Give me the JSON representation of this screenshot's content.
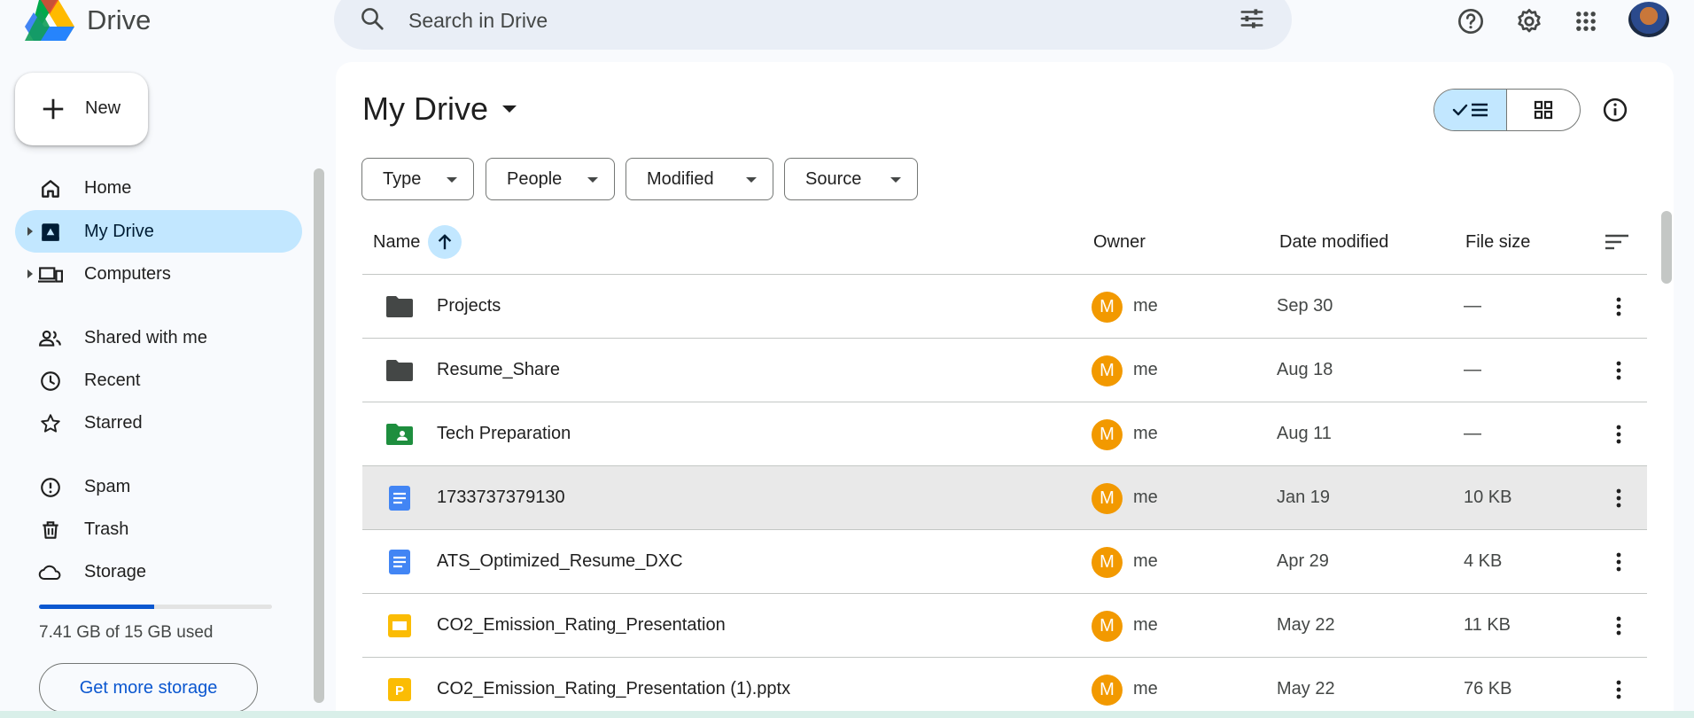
{
  "app": {
    "name": "Drive"
  },
  "search": {
    "placeholder": "Search in Drive"
  },
  "sidebar": {
    "new_label": "New",
    "items": [
      {
        "label": "Home",
        "icon": "home-icon"
      },
      {
        "label": "My Drive",
        "icon": "my-drive-icon",
        "active": true
      },
      {
        "label": "Computers",
        "icon": "computers-icon"
      },
      {
        "label": "Shared with me",
        "icon": "shared-icon"
      },
      {
        "label": "Recent",
        "icon": "clock-icon"
      },
      {
        "label": "Starred",
        "icon": "star-icon"
      },
      {
        "label": "Spam",
        "icon": "spam-icon"
      },
      {
        "label": "Trash",
        "icon": "trash-icon"
      },
      {
        "label": "Storage",
        "icon": "cloud-icon"
      }
    ],
    "storage": {
      "text": "7.41 GB of 15 GB used",
      "used_fraction": 0.494,
      "button": "Get more storage"
    }
  },
  "main": {
    "title": "My Drive",
    "filters": [
      "Type",
      "People",
      "Modified",
      "Source"
    ],
    "columns": {
      "name": "Name",
      "owner": "Owner",
      "date": "Date modified",
      "size": "File size"
    },
    "rows": [
      {
        "name": "Projects",
        "type": "folder",
        "owner_initial": "M",
        "owner": "me",
        "date": "Sep 30",
        "size": "—"
      },
      {
        "name": "Resume_Share",
        "type": "folder",
        "owner_initial": "M",
        "owner": "me",
        "date": "Aug 18",
        "size": "—"
      },
      {
        "name": "Tech Preparation",
        "type": "shared-folder",
        "owner_initial": "M",
        "owner": "me",
        "date": "Aug 11",
        "size": "—"
      },
      {
        "name": "1733737379130",
        "type": "doc",
        "owner_initial": "M",
        "owner": "me",
        "date": "Jan 19",
        "size": "10 KB",
        "selected": true
      },
      {
        "name": "ATS_Optimized_Resume_DXC",
        "type": "doc",
        "owner_initial": "M",
        "owner": "me",
        "date": "Apr 29",
        "size": "4 KB"
      },
      {
        "name": "CO2_Emission_Rating_Presentation",
        "type": "slides",
        "owner_initial": "M",
        "owner": "me",
        "date": "May 22",
        "size": "11 KB"
      },
      {
        "name": "CO2_Emission_Rating_Presentation (1).pptx",
        "type": "pptx",
        "owner_initial": "M",
        "owner": "me",
        "date": "May 22",
        "size": "76 KB"
      }
    ]
  },
  "colors": {
    "accent": "#0b57d0",
    "active_bg": "#c2e7ff",
    "owner_avatar": "#f29900"
  }
}
